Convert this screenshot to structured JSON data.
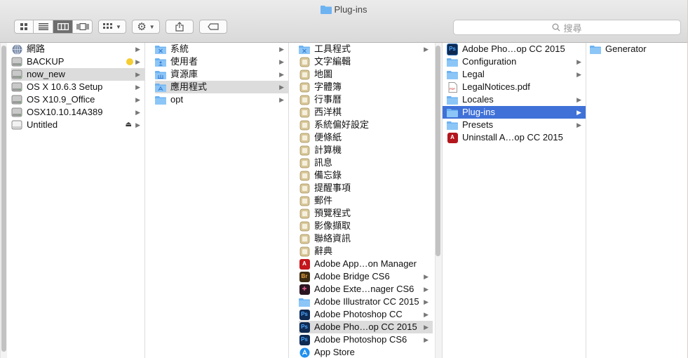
{
  "window": {
    "title": "Plug-ins"
  },
  "toolbar": {
    "view_buttons": [
      "icon-view",
      "list-view",
      "column-view",
      "coverflow-view"
    ],
    "search_placeholder": "搜尋"
  },
  "columns": {
    "col1": [
      {
        "label": "網路",
        "icon": "globe"
      },
      {
        "label": "BACKUP",
        "icon": "drive",
        "tag": "yellow"
      },
      {
        "label": "now_new",
        "icon": "drive",
        "selected": true
      },
      {
        "label": "OS X 10.6.3 Setup",
        "icon": "drive"
      },
      {
        "label": "OS X10.9_Office",
        "icon": "drive"
      },
      {
        "label": "OSX10.10.14A389",
        "icon": "drive"
      },
      {
        "label": "Untitled",
        "icon": "removable",
        "eject": true
      }
    ],
    "col2": [
      {
        "label": "系統",
        "icon": "folder-x"
      },
      {
        "label": "使用者",
        "icon": "folder-user"
      },
      {
        "label": "資源庫",
        "icon": "folder-lib"
      },
      {
        "label": "應用程式",
        "icon": "folder-app",
        "selected": true
      },
      {
        "label": "opt",
        "icon": "folder"
      }
    ],
    "col3": [
      {
        "label": "工具程式",
        "icon": "folder-util",
        "arrow": true
      },
      {
        "label": "文字編輯",
        "icon": "app"
      },
      {
        "label": "地圖",
        "icon": "app"
      },
      {
        "label": "字體簿",
        "icon": "app"
      },
      {
        "label": "行事曆",
        "icon": "app"
      },
      {
        "label": "西洋棋",
        "icon": "app"
      },
      {
        "label": "系統偏好設定",
        "icon": "app"
      },
      {
        "label": "便條紙",
        "icon": "app"
      },
      {
        "label": "計算機",
        "icon": "app"
      },
      {
        "label": "訊息",
        "icon": "app"
      },
      {
        "label": "備忘錄",
        "icon": "app"
      },
      {
        "label": "提醒事項",
        "icon": "app"
      },
      {
        "label": "郵件",
        "icon": "app"
      },
      {
        "label": "預覽程式",
        "icon": "app"
      },
      {
        "label": "影像擷取",
        "icon": "app"
      },
      {
        "label": "聯絡資訊",
        "icon": "app"
      },
      {
        "label": "辭典",
        "icon": "app"
      },
      {
        "label": "Adobe App…on Manager",
        "icon": "adobe-red"
      },
      {
        "label": "Adobe Bridge CS6",
        "icon": "adobe-br",
        "arrow": true
      },
      {
        "label": "Adobe Exte…nager CS6",
        "icon": "adobe-ext",
        "arrow": true
      },
      {
        "label": "Adobe Illustrator CC 2015",
        "icon": "folder",
        "arrow": true
      },
      {
        "label": "Adobe Photoshop CC",
        "icon": "adobe-ps",
        "arrow": true
      },
      {
        "label": "Adobe Pho…op CC 2015",
        "icon": "adobe-ps",
        "arrow": true,
        "selected": true
      },
      {
        "label": "Adobe Photoshop CS6",
        "icon": "adobe-ps",
        "arrow": true
      },
      {
        "label": "App Store",
        "icon": "appstore"
      }
    ],
    "col4": [
      {
        "label": "Adobe Pho…op CC 2015",
        "icon": "ps-app"
      },
      {
        "label": "Configuration",
        "icon": "folder",
        "arrow": true
      },
      {
        "label": "Legal",
        "icon": "folder",
        "arrow": true
      },
      {
        "label": "LegalNotices.pdf",
        "icon": "pdf"
      },
      {
        "label": "Locales",
        "icon": "folder",
        "arrow": true
      },
      {
        "label": "Plug-ins",
        "icon": "folder",
        "arrow": true,
        "selected": true
      },
      {
        "label": "Presets",
        "icon": "folder",
        "arrow": true
      },
      {
        "label": "Uninstall A…op CC 2015",
        "icon": "uninstall"
      }
    ],
    "col5": [
      {
        "label": "Generator",
        "icon": "folder"
      }
    ]
  },
  "colors": {
    "selection_blue": "#3f71d8",
    "folder_blue": "#6db3f2",
    "tag_yellow": "#f5cd30"
  }
}
